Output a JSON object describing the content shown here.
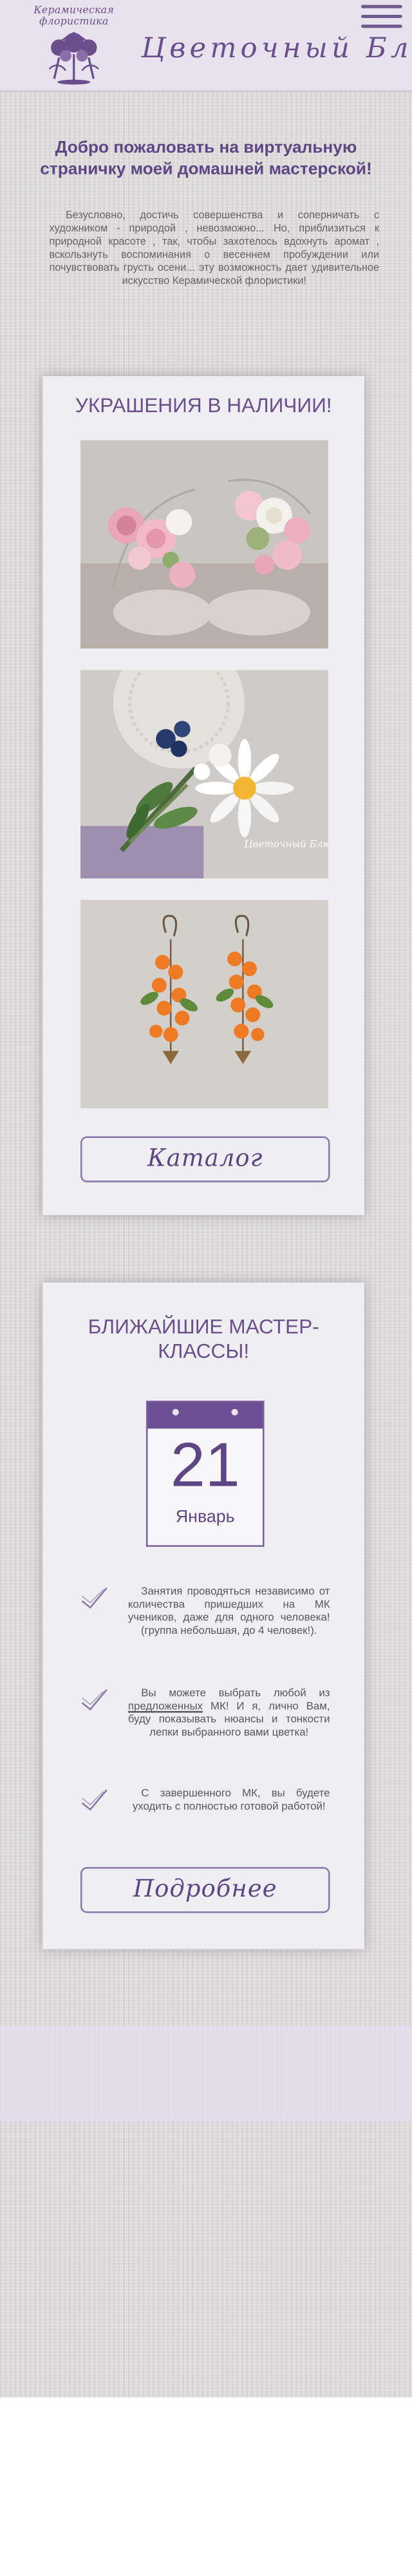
{
  "header": {
    "logo_text": "Керамическая флористика",
    "brand": "Цветочный Блюз",
    "menu_icon": "hamburger-menu-icon"
  },
  "welcome": {
    "title": "Добро пожаловать на виртуальную страничку моей домашней мастерской!",
    "text": "Безусловно, достичь совершенства и соперничать с художником - природой , невозможно... Но, приблизиться к природной красоте , так, чтобы захотелось вдохнуть аромат , вскользнуть воспоминания о весеннем пробуждении или почувствовать грусть осени... эту возможность дает удивительное искусство Керамической флористики!"
  },
  "jewelry": {
    "title": "УКРАШЕНИЯ В НАЛИЧИИ!",
    "photo_watermark": "Цветочный Блюз",
    "button_label": "Каталог"
  },
  "classes": {
    "title": "БЛИЖАЙШИЕ МАСТЕР-КЛАССЫ!",
    "calendar": {
      "day": "21",
      "month": "Январь"
    },
    "features": [
      {
        "icon": "check-icon",
        "text_before": "Занятия проводяться независимо от количества пришедших на МК учеников, даже для одного человека! (группа небольшая, до 4 человек!).",
        "underlined": "",
        "text_after": ""
      },
      {
        "icon": "check-icon",
        "text_before": "Вы можете выбрать любой из ",
        "underlined": "предложенных",
        "text_after": " МК! И я, лично Вам, буду показывать нюансы и тонкости лепки выбранного вами цветка!"
      },
      {
        "icon": "check-icon",
        "text_before": "С завершенного МК, вы будете уходить с полностью готовой работой!",
        "underlined": "",
        "text_after": ""
      }
    ],
    "button_label": "Подробнее"
  },
  "colors": {
    "accent": "#6a4f8c",
    "header_bg": "#e7e2ee",
    "card_bg": "#efeef2",
    "page_bg": "#dddbdb"
  }
}
